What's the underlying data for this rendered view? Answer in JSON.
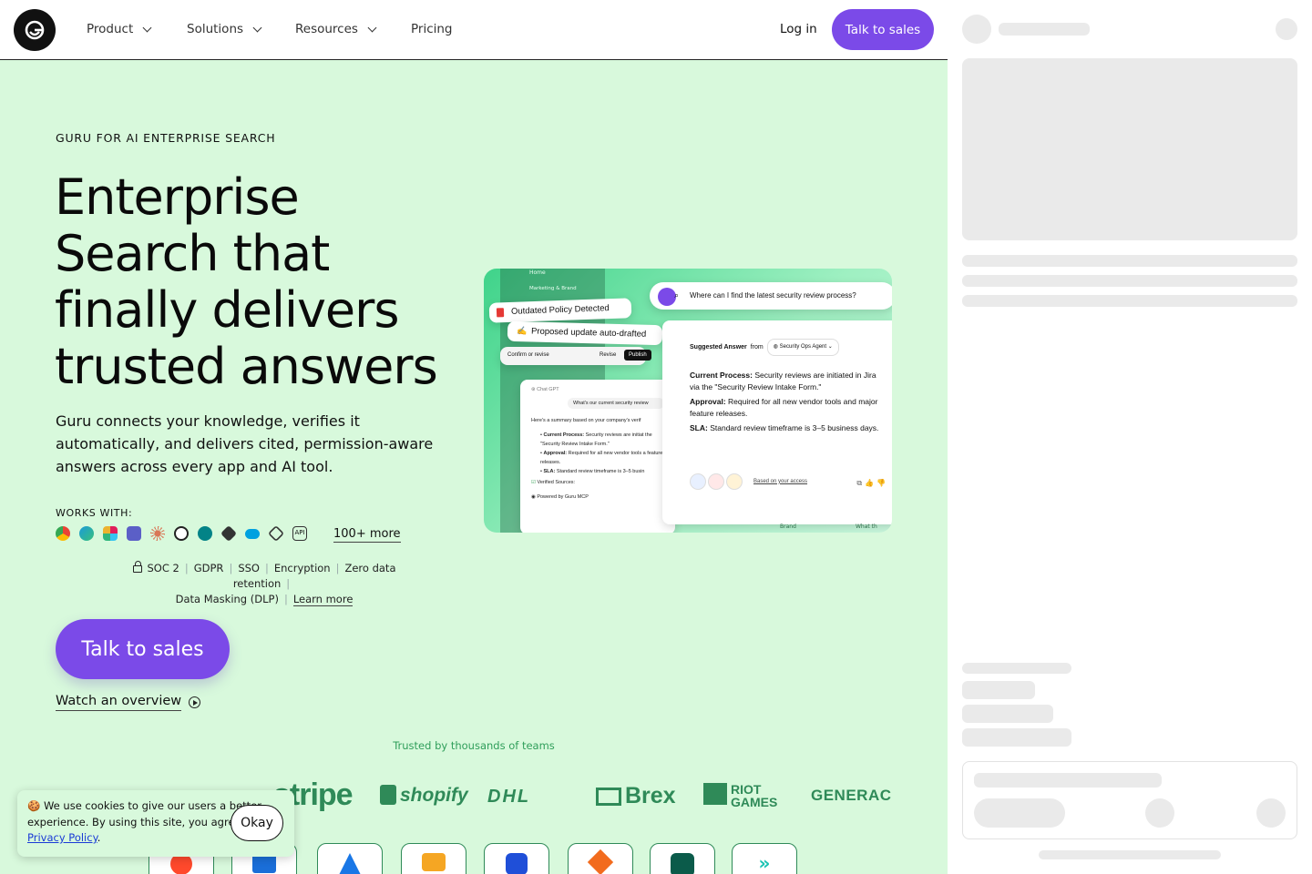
{
  "nav": {
    "items": [
      {
        "label": "Product",
        "has_dropdown": true
      },
      {
        "label": "Solutions",
        "has_dropdown": true
      },
      {
        "label": "Resources",
        "has_dropdown": true
      },
      {
        "label": "Pricing",
        "has_dropdown": false
      }
    ],
    "login": "Log in",
    "cta": "Talk to sales"
  },
  "hero": {
    "eyebrow": "GURU FOR AI ENTERPRISE SEARCH",
    "headline": "Enterprise Search that finally delivers trusted answers",
    "subtitle": "Guru connects your knowledge, verifies it automatically, and delivers cited, permission-aware answers across every app and AI tool.",
    "works_with_label": "WORKS WITH:",
    "apps": [
      "chrome-icon",
      "edge-icon",
      "slack-icon",
      "teams-icon",
      "claude-icon",
      "openai-icon",
      "sharepoint-icon",
      "bedrock-icon",
      "salesforce-icon",
      "perplexity-icon",
      "api-icon"
    ],
    "more": "100+ more",
    "compliance": [
      "SOC 2",
      "GDPR",
      "SSO",
      "Encryption",
      "Zero data retention",
      "Data Masking (DLP)"
    ],
    "learn_more": "Learn more",
    "cta": "Talk to sales",
    "watch": "Watch an overview"
  },
  "mockup": {
    "side_home": "Home",
    "side_marketing": "Marketing & Brand",
    "alert": "Outdated Policy Detected",
    "proposed": "Proposed update auto-drafted",
    "confirm": "Confirm or revise",
    "revise": "Revise",
    "publish": "Publish",
    "chatgpt": "Chat GPT",
    "chat_question": "What's our current security review",
    "chat_summary": "Here's a summary based on your company's verif",
    "chat_b1_label": "Current Process:",
    "chat_b1": "Security reviews are initiat the \"Security Review Intake Form.\"",
    "chat_b2_label": "Approval:",
    "chat_b2": "Required for all new vendor tools a feature releases.",
    "chat_b3_label": "SLA:",
    "chat_b3": "Standard review timeframe is 3–5 busin",
    "verified": "Verified Sources:",
    "powered": "Powered by Guru MCP",
    "search_query": "Where can I find the latest security review process?",
    "suggested": "Suggested Answer",
    "from": "from",
    "agent": "Security Ops Agent",
    "p1_label": "Current Process:",
    "p1": "Security reviews are initiated in Jira via the \"Security Review Intake Form.\"",
    "p2_label": "Approval:",
    "p2": "Required for all new vendor tools and major feature releases.",
    "p3_label": "SLA:",
    "p3": "Standard review timeframe is 3–5 business days.",
    "access": "Based on your access",
    "bg_brand": "Brand",
    "bg_what": "What th"
  },
  "trusted": {
    "label": "Trusted by thousands of teams",
    "brands": [
      "stripe",
      "shopify",
      "DHL",
      "Brex",
      "RIOT GAMES",
      "GENERAC"
    ]
  },
  "cookie": {
    "text": "We use cookies to give our users a better experience.  By using this site, you agree to our",
    "link": "Privacy Policy",
    "end": ".",
    "okay": "Okay"
  },
  "colors": {
    "accent": "#7b4ae8",
    "hero_bg": "#d8f9dc",
    "brand_green": "#2f8a58"
  }
}
